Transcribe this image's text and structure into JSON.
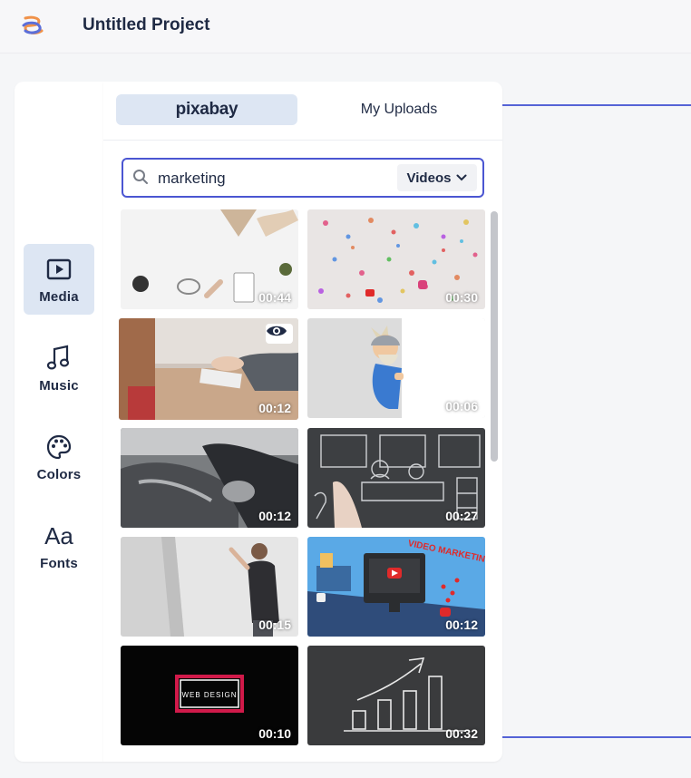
{
  "header": {
    "title": "Untitled Project"
  },
  "sidebar": {
    "items": [
      {
        "label": "Media",
        "icon": "media-play-icon",
        "active": true
      },
      {
        "label": "Music",
        "icon": "music-note-icon",
        "active": false
      },
      {
        "label": "Colors",
        "icon": "palette-icon",
        "active": false
      },
      {
        "label": "Fonts",
        "icon": "fonts-aa-icon",
        "glyph": "Aa",
        "active": false
      }
    ]
  },
  "tabs": [
    {
      "label": "pixabay",
      "active": true
    },
    {
      "label": "My Uploads",
      "active": false
    }
  ],
  "search": {
    "value": "marketing",
    "type_label": "Videos"
  },
  "results": [
    {
      "duration": "00:44"
    },
    {
      "duration": "00:30"
    },
    {
      "duration": "00:12",
      "preview": true
    },
    {
      "duration": "00:06"
    },
    {
      "duration": "00:12"
    },
    {
      "duration": "00:27"
    },
    {
      "duration": "00:15"
    },
    {
      "duration": "00:12"
    },
    {
      "duration": "00:10",
      "caption": "WEB DESIGN"
    },
    {
      "duration": "00:32"
    }
  ],
  "colors": {
    "accent": "#4b56d2",
    "active_bg": "#dde6f3",
    "logo_orange": "#f0924a",
    "logo_blue": "#5c6fd9"
  }
}
